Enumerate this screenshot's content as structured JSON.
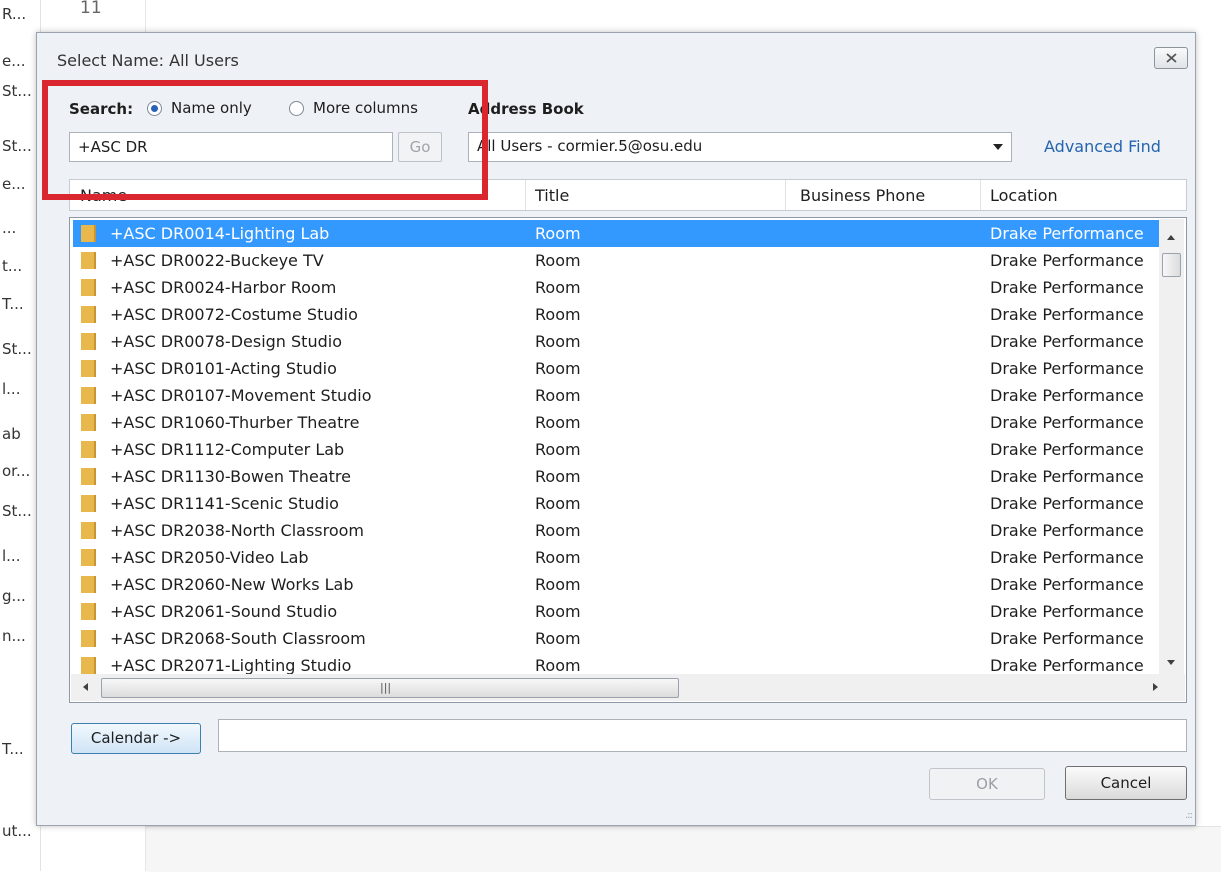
{
  "background": {
    "items": [
      "R...",
      "e...",
      "St...",
      "St...",
      "e...",
      "...",
      "t...",
      "T...",
      "St...",
      "l...",
      "ab",
      "or...",
      "St...",
      "l...",
      "g...",
      "n...",
      "T...",
      "ut..."
    ],
    "number": "11"
  },
  "dialog": {
    "title": "Select Name: All Users",
    "search_label": "Search:",
    "radio_name_only": "Name only",
    "radio_more_columns": "More columns",
    "address_book_label": "Address Book",
    "search_value": "+ASC DR",
    "go_label": "Go",
    "address_book_value": "All Users - cormier.5@osu.edu",
    "advanced_find": "Advanced Find"
  },
  "columns": {
    "name": "Name",
    "title": "Title",
    "phone": "Business Phone",
    "location": "Location"
  },
  "rows": [
    {
      "name": "+ASC DR0014-Lighting Lab",
      "title": "Room",
      "location": "Drake Performance"
    },
    {
      "name": "+ASC DR0022-Buckeye TV",
      "title": "Room",
      "location": "Drake Performance"
    },
    {
      "name": "+ASC DR0024-Harbor Room",
      "title": "Room",
      "location": "Drake Performance"
    },
    {
      "name": "+ASC DR0072-Costume Studio",
      "title": "Room",
      "location": "Drake Performance"
    },
    {
      "name": "+ASC DR0078-Design Studio",
      "title": "Room",
      "location": "Drake Performance"
    },
    {
      "name": "+ASC DR0101-Acting Studio",
      "title": "Room",
      "location": "Drake Performance"
    },
    {
      "name": "+ASC DR0107-Movement Studio",
      "title": "Room",
      "location": "Drake Performance"
    },
    {
      "name": "+ASC DR1060-Thurber Theatre",
      "title": "Room",
      "location": "Drake Performance"
    },
    {
      "name": "+ASC DR1112-Computer Lab",
      "title": "Room",
      "location": "Drake Performance"
    },
    {
      "name": "+ASC DR1130-Bowen Theatre",
      "title": "Room",
      "location": "Drake Performance"
    },
    {
      "name": "+ASC DR1141-Scenic Studio",
      "title": "Room",
      "location": "Drake Performance"
    },
    {
      "name": "+ASC DR2038-North Classroom",
      "title": "Room",
      "location": "Drake Performance"
    },
    {
      "name": "+ASC DR2050-Video Lab",
      "title": "Room",
      "location": "Drake Performance"
    },
    {
      "name": "+ASC DR2060-New Works Lab",
      "title": "Room",
      "location": "Drake Performance"
    },
    {
      "name": "+ASC DR2061-Sound Studio",
      "title": "Room",
      "location": "Drake Performance"
    },
    {
      "name": "+ASC DR2068-South Classroom",
      "title": "Room",
      "location": "Drake Performance"
    },
    {
      "name": "+ASC DR2071-Lighting Studio",
      "title": "Room",
      "location": "Drake Performance"
    }
  ],
  "footer": {
    "calendar_label": "Calendar ->",
    "calendar_value": "",
    "ok_label": "OK",
    "cancel_label": "Cancel"
  },
  "colors": {
    "selection": "#3399ff",
    "highlight_box": "#d9262f",
    "link": "#2464b0"
  }
}
